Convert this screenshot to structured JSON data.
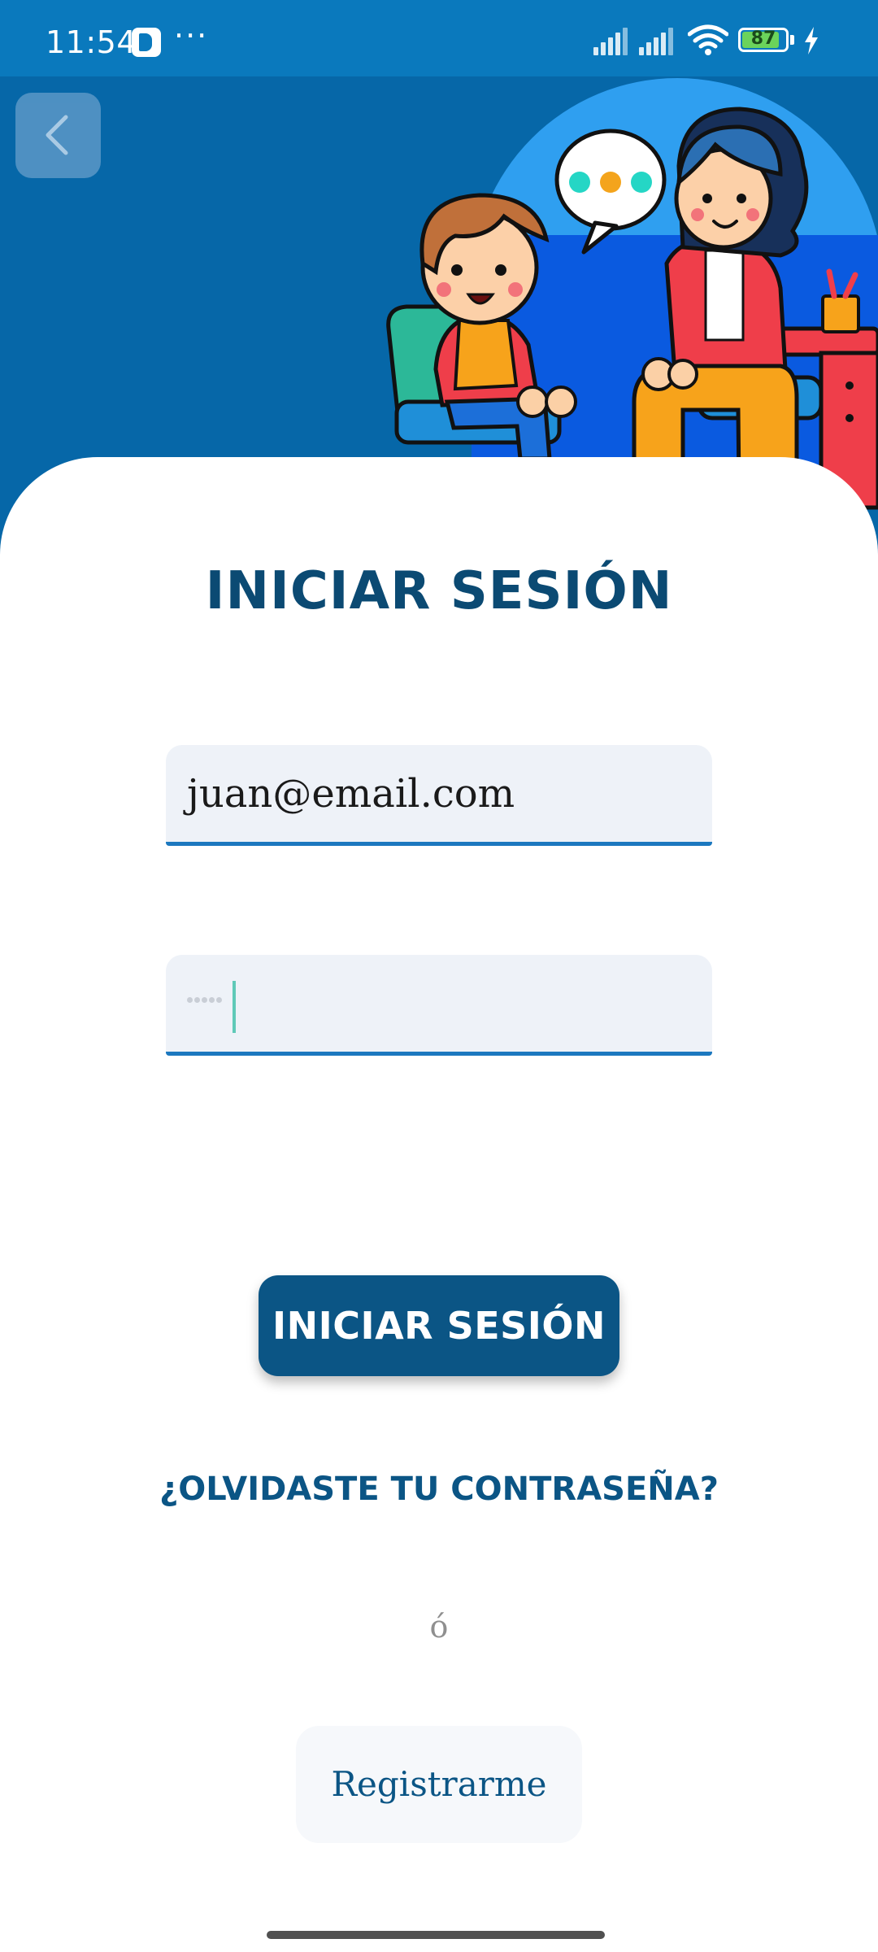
{
  "status_bar": {
    "time": "11:54",
    "dots": "···",
    "battery_level": "87",
    "battery_percent": 87,
    "app_icon": "b-app-icon",
    "icons": [
      "signal-icon",
      "signal-icon",
      "wifi-icon",
      "battery-icon",
      "charging-bolt-icon"
    ]
  },
  "header": {
    "back_icon": "chevron-left-icon",
    "illustration": "child-and-therapist-illustration"
  },
  "form": {
    "title": "INICIAR SESIÓN",
    "email_value": "juan@email.com",
    "password_masked": "••••"
  },
  "actions": {
    "login_label": "INICIAR SESIÓN",
    "forgot_label": "¿OLVIDASTE TU CONTRASEÑA?",
    "or_label": "ó",
    "register_label": "Registrarme"
  },
  "colors": {
    "primary": "#0b5585",
    "header_bg": "#0667a8",
    "status_bg": "#0a79bd",
    "field_bg": "#eef2f8",
    "field_underline": "#1c78bf"
  }
}
